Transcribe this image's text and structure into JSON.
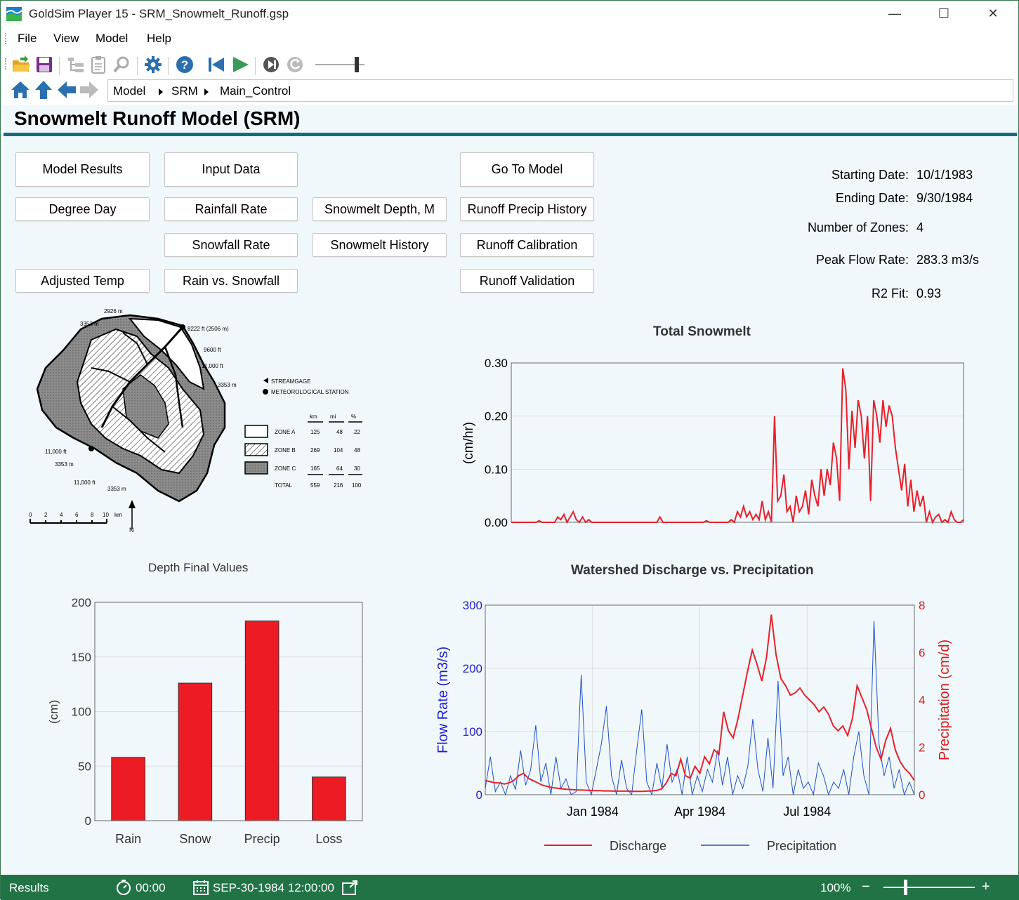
{
  "window": {
    "app_name": "GoldSim Player 15",
    "file_title": " - SRM_Snowmelt_Runoff.gsp",
    "minimize": "—",
    "maximize": "☐",
    "close": "✕"
  },
  "menu": [
    "File",
    "View",
    "Model",
    "Help"
  ],
  "breadcrumb": [
    "Model",
    "SRM",
    "Main_Control"
  ],
  "page": {
    "title": "Snowmelt Runoff Model (SRM)"
  },
  "buttons": {
    "model_results": "Model Results",
    "input_data": "Input Data",
    "go_to_model": "Go To Model",
    "degree_day": "Degree Day",
    "rainfall_rate": "Rainfall Rate",
    "snowmelt_depth": "Snowmelt Depth, M",
    "runoff_precip_history": "Runoff Precip History",
    "snowfall_rate": "Snowfall Rate",
    "snowmelt_history": "Snowmelt History",
    "runoff_calibration": "Runoff Calibration",
    "adjusted_temp": "Adjusted Temp",
    "rain_vs_snowfall": "Rain vs. Snowfall",
    "runoff_validation": "Runoff Validation"
  },
  "info": [
    {
      "label": "Starting Date:",
      "value": "10/1/1983"
    },
    {
      "label": "Ending Date:",
      "value": "9/30/1984"
    },
    {
      "label": "Number of Zones:",
      "value": "4"
    },
    {
      "label": "Peak Flow Rate:",
      "value": "283.3 m3/s"
    },
    {
      "label": "R2 Fit:",
      "value": "0.93"
    }
  ],
  "map": {
    "elevations": [
      "2926 m",
      "3353 m",
      "8222 ft (2506 m)",
      "9600 ft",
      "11,000 ft",
      "3353 m",
      "11,000 ft",
      "3353 m",
      "11,000 ft",
      "3353 m"
    ],
    "legend_streamgage": "STREAMGAGE",
    "legend_station": "METEOROLOGICAL STATION",
    "table_headers": [
      "km",
      "mi",
      "%"
    ],
    "zones": [
      {
        "name": "ZONE A",
        "km2": "125",
        "mi2": "48",
        "pct": "22"
      },
      {
        "name": "ZONE B",
        "km2": "269",
        "mi2": "104",
        "pct": "48"
      },
      {
        "name": "ZONE C",
        "km2": "165",
        "mi2": "64",
        "pct": "30"
      },
      {
        "name": "TOTAL",
        "km2": "559",
        "mi2": "216",
        "pct": "100"
      }
    ],
    "scale_ticks": [
      "0",
      "2",
      "4",
      "6",
      "8",
      "10"
    ],
    "scale_unit": "km",
    "north": "N",
    "colors": {
      "zone_c": "#8c8c8c"
    }
  },
  "charts": {
    "snowmelt_title": "Total Snowmelt",
    "bar_title": "Depth Final Values",
    "discharge_title": "Watershed Discharge vs. Precipitation"
  },
  "chart_data": [
    {
      "type": "line",
      "title": "Total Snowmelt",
      "ylabel": "(cm/hr)",
      "ylim": [
        0,
        0.3
      ],
      "yticks": [
        "0.00",
        "0.10",
        "0.20",
        "0.30"
      ],
      "x_start": "10/1/1983",
      "x_end": "9/30/1984",
      "grid": true,
      "series": [
        {
          "color": "#e8202a",
          "values": [
            0,
            0,
            0,
            0,
            0,
            0,
            0,
            0,
            0,
            0.003,
            0,
            0,
            0,
            0,
            0,
            0.01,
            0.005,
            0.015,
            0,
            0.01,
            0.02,
            0.005,
            0,
            0.01,
            0,
            0.005,
            0,
            0,
            0,
            0,
            0,
            0,
            0,
            0,
            0,
            0,
            0,
            0,
            0,
            0,
            0,
            0,
            0,
            0,
            0,
            0,
            0,
            0,
            0.01,
            0,
            0,
            0,
            0,
            0,
            0,
            0,
            0,
            0,
            0,
            0,
            0,
            0,
            0,
            0.003,
            0,
            0,
            0,
            0,
            0,
            0,
            0,
            0.005,
            0,
            0.02,
            0.01,
            0.03,
            0.01,
            0.02,
            0.005,
            0.015,
            0.005,
            0.04,
            0.005,
            0.02,
            0,
            0.2,
            0.04,
            0.05,
            0.09,
            0.02,
            0.03,
            0,
            0.05,
            0.02,
            0.03,
            0.06,
            0.015,
            0.08,
            0.05,
            0.03,
            0.1,
            0.05,
            0.1,
            0.07,
            0.15,
            0.12,
            0.04,
            0.29,
            0.25,
            0.1,
            0.21,
            0.14,
            0.23,
            0.2,
            0.12,
            0.2,
            0.04,
            0.23,
            0.2,
            0.15,
            0.23,
            0.18,
            0.22,
            0.2,
            0.14,
            0.1,
            0.06,
            0.11,
            0.03,
            0.08,
            0.02,
            0.06,
            0.03,
            0.05,
            0,
            0.02,
            0,
            0.01,
            0.015,
            0,
            0.005,
            0,
            0.02,
            0.005,
            0,
            0,
            0.005
          ]
        }
      ]
    },
    {
      "type": "bar",
      "title": "Depth Final Values",
      "ylabel": "(cm)",
      "ylim": [
        0,
        200
      ],
      "yticks": [
        "0",
        "50",
        "100",
        "150",
        "200"
      ],
      "categories": [
        "Rain",
        "Snow",
        "Precip",
        "Loss"
      ],
      "values": [
        58,
        126,
        183,
        40
      ],
      "color": "#ed1c24"
    },
    {
      "type": "line",
      "title": "Watershed Discharge vs. Precipitation",
      "ylabel": "Flow Rate (m3/s)",
      "y2label": "Precipitation (cm/d)",
      "ylim": [
        0,
        300
      ],
      "y2lim": [
        0,
        8
      ],
      "yticks": [
        "0",
        "100",
        "200",
        "300"
      ],
      "y2ticks": [
        "0",
        "2",
        "4",
        "6",
        "8"
      ],
      "xticks": [
        "Jan 1984",
        "Apr 1984",
        "Jul 1984"
      ],
      "grid": true,
      "legend_position": "bottom",
      "series": [
        {
          "name": "Discharge",
          "axis": "right",
          "color": "#e8202a",
          "values": [
            0.6,
            0.55,
            0.5,
            0.5,
            0.45,
            0.5,
            0.6,
            0.8,
            0.9,
            0.7,
            0.6,
            0.5,
            0.4,
            0.35,
            0.3,
            0.28,
            0.25,
            0.23,
            0.22,
            0.2,
            0.2,
            0.19,
            0.18,
            0.17,
            0.17,
            0.16,
            0.16,
            0.15,
            0.15,
            0.15,
            0.15,
            0.14,
            0.14,
            0.14,
            0.15,
            0.16,
            0.18,
            0.25,
            0.5,
            0.9,
            0.8,
            1.5,
            0.8,
            0.7,
            1.2,
            0.9,
            1.6,
            1.3,
            1.9,
            1.7,
            3.5,
            2.7,
            2.4,
            3.2,
            4.2,
            5.2,
            6.1,
            5.5,
            4.8,
            5.8,
            7.6,
            5.9,
            4.9,
            4.6,
            4.2,
            4.3,
            4.5,
            4.2,
            4.0,
            3.8,
            3.5,
            3.7,
            3.4,
            2.9,
            2.7,
            2.9,
            2.5,
            3.2,
            4.6,
            4.1,
            3.6,
            2.8,
            2.0,
            1.5,
            2.3,
            2.8,
            1.9,
            1.4,
            1.1,
            0.9,
            0.6
          ]
        },
        {
          "name": "Precipitation",
          "axis": "left",
          "color": "#1f4fc8",
          "values": [
            10,
            60,
            5,
            20,
            0,
            30,
            8,
            70,
            15,
            40,
            110,
            20,
            50,
            0,
            60,
            10,
            25,
            0,
            5,
            190,
            20,
            0,
            40,
            80,
            140,
            30,
            0,
            55,
            10,
            0,
            70,
            135,
            20,
            0,
            50,
            10,
            80,
            20,
            40,
            0,
            60,
            0,
            30,
            5,
            40,
            20,
            70,
            15,
            60,
            0,
            30,
            10,
            45,
            120,
            40,
            5,
            90,
            10,
            180,
            30,
            60,
            0,
            40,
            10,
            20,
            0,
            50,
            30,
            0,
            20,
            10,
            40,
            0,
            60,
            100,
            30,
            0,
            275,
            80,
            30,
            60,
            10,
            40,
            0,
            20,
            0
          ]
        }
      ]
    }
  ],
  "status": {
    "mode": "Results",
    "elapsed": "00:00",
    "datetime": "SEP-30-1984 12:00:00",
    "zoom": "100%",
    "zoom_minus": "−",
    "zoom_plus": "+"
  }
}
